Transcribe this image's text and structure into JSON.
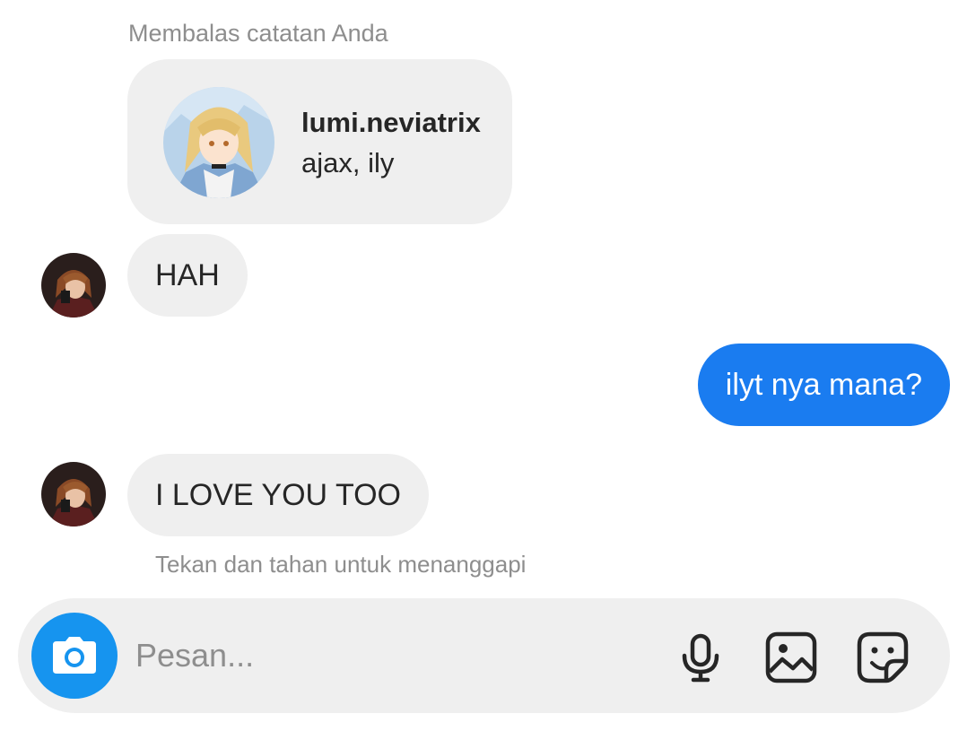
{
  "thread": {
    "reply_caption": "Membalas catatan Anda",
    "note": {
      "username": "lumi.neviatrix",
      "text": "ajax, ily"
    },
    "messages": [
      {
        "side": "in",
        "text": "HAH"
      },
      {
        "side": "out",
        "text": "ilyt nya mana?"
      },
      {
        "side": "in",
        "text": "I LOVE YOU TOO"
      }
    ],
    "hint": "Tekan dan tahan untuk menanggapi"
  },
  "composer": {
    "placeholder": "Pesan...",
    "icons": [
      "camera-icon",
      "microphone-icon",
      "gallery-icon",
      "sticker-icon"
    ]
  },
  "colors": {
    "outgoing_bubble": "#1a7cf0",
    "incoming_bubble": "#efefef",
    "camera_button": "#1694ef",
    "muted_text": "#8e8e8e"
  }
}
